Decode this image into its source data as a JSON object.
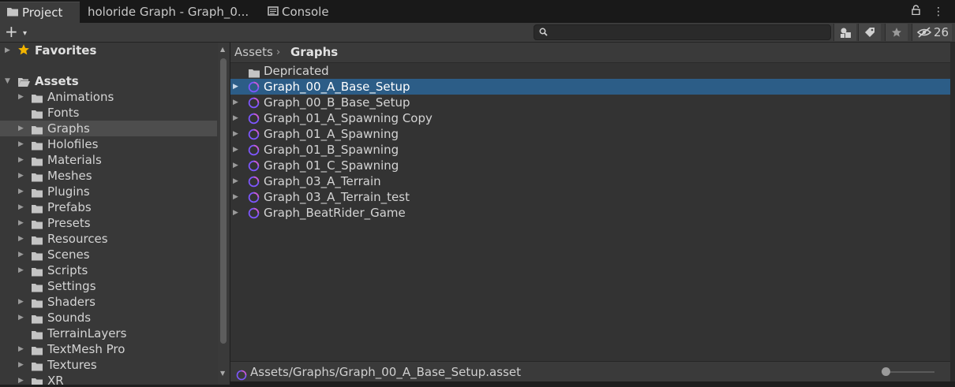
{
  "tabs": [
    {
      "label": "Project",
      "icon": "folder-icon"
    },
    {
      "label": "holoride Graph - Graph_0...",
      "icon": ""
    },
    {
      "label": "Console",
      "icon": "console-icon"
    }
  ],
  "tab_actions": {
    "lock": "🔒",
    "menu": "⋮"
  },
  "toolbar": {
    "create_label": "+",
    "create_caret": "▾",
    "search_placeholder": "",
    "hidden_count": "26"
  },
  "sidebar": {
    "favorites": "Favorites",
    "assets": "Assets",
    "folders": [
      {
        "label": "Animations",
        "expandable": true
      },
      {
        "label": "Fonts",
        "expandable": false
      },
      {
        "label": "Graphs",
        "expandable": true,
        "selected": true
      },
      {
        "label": "Holofiles",
        "expandable": true
      },
      {
        "label": "Materials",
        "expandable": true
      },
      {
        "label": "Meshes",
        "expandable": true
      },
      {
        "label": "Plugins",
        "expandable": true
      },
      {
        "label": "Prefabs",
        "expandable": true
      },
      {
        "label": "Presets",
        "expandable": true
      },
      {
        "label": "Resources",
        "expandable": true
      },
      {
        "label": "Scenes",
        "expandable": true
      },
      {
        "label": "Scripts",
        "expandable": true
      },
      {
        "label": "Settings",
        "expandable": false
      },
      {
        "label": "Shaders",
        "expandable": true
      },
      {
        "label": "Sounds",
        "expandable": true
      },
      {
        "label": "TerrainLayers",
        "expandable": false
      },
      {
        "label": "TextMesh Pro",
        "expandable": true
      },
      {
        "label": "Textures",
        "expandable": true
      },
      {
        "label": "XR",
        "expandable": true
      }
    ]
  },
  "breadcrumb": {
    "root": "Assets",
    "separator": "›",
    "current": "Graphs"
  },
  "files": [
    {
      "label": "Depricated",
      "type": "folder"
    },
    {
      "label": "Graph_00_A_Base_Setup",
      "type": "graph",
      "selected": true
    },
    {
      "label": "Graph_00_B_Base_Setup",
      "type": "graph"
    },
    {
      "label": "Graph_01_A_Spawning Copy",
      "type": "graph"
    },
    {
      "label": "Graph_01_A_Spawning",
      "type": "graph"
    },
    {
      "label": "Graph_01_B_Spawning",
      "type": "graph"
    },
    {
      "label": "Graph_01_C_Spawning",
      "type": "graph"
    },
    {
      "label": "Graph_03_A_Terrain",
      "type": "graph"
    },
    {
      "label": "Graph_03_A_Terrain_test",
      "type": "graph"
    },
    {
      "label": "Graph_BeatRider_Game",
      "type": "graph"
    }
  ],
  "status": {
    "path": "Assets/Graphs/Graph_00_A_Base_Setup.asset"
  },
  "colors": {
    "selection": "#2c5d87",
    "graph_ring_a": "#7e57ff",
    "graph_ring_b": "#c85ad6",
    "favorite_star": "#f2b400"
  }
}
